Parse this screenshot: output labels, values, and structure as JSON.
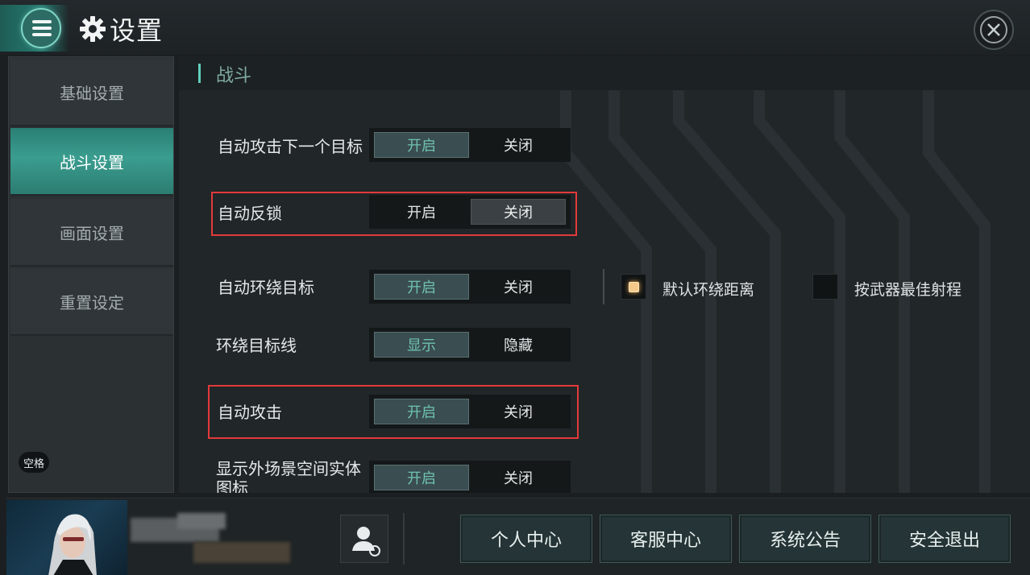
{
  "header": {
    "title": "设置",
    "menu_icon": "hamburger-menu-icon",
    "settings_icon": "gear-icon",
    "close_icon": "close-icon"
  },
  "sidebar": {
    "items": [
      {
        "label": "基础设置",
        "active": false
      },
      {
        "label": "战斗设置",
        "active": true
      },
      {
        "label": "画面设置",
        "active": false
      },
      {
        "label": "重置设定",
        "active": false
      }
    ],
    "key_hint": "空格"
  },
  "section": {
    "title": "战斗"
  },
  "settings": [
    {
      "label": "自动攻击下一个目标",
      "on": "开启",
      "off": "关闭",
      "selected": "on"
    },
    {
      "label": "自动反锁",
      "on": "开启",
      "off": "关闭",
      "selected": "off"
    },
    {
      "label": "自动环绕目标",
      "on": "开启",
      "off": "关闭",
      "selected": "on"
    },
    {
      "label": "环绕目标线",
      "on": "显示",
      "off": "隐藏",
      "selected": "on"
    },
    {
      "label": "自动攻击",
      "on": "开启",
      "off": "关闭",
      "selected": "on"
    },
    {
      "label": "显示外场景空间实体图标",
      "on": "开启",
      "off": "关闭",
      "selected": "on"
    }
  ],
  "orbit_distance": {
    "options": [
      {
        "label": "默认环绕距离",
        "checked": true
      },
      {
        "label": "按武器最佳射程",
        "checked": false
      }
    ]
  },
  "colors": {
    "accent_teal": "#3a9d8f",
    "highlight_red": "#e23a3a",
    "checked_orange": "#f6c98a"
  },
  "bottom": {
    "avatar": "player-portrait",
    "profile_icon": "profile-switch-icon",
    "buttons": [
      "个人中心",
      "客服中心",
      "系统公告",
      "安全退出"
    ]
  }
}
